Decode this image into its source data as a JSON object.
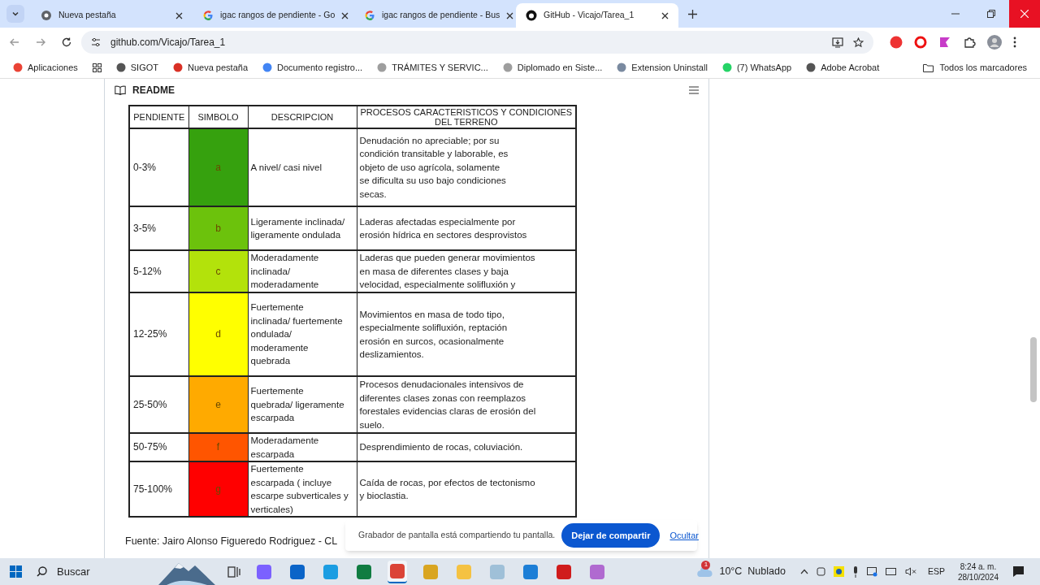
{
  "tabs": [
    {
      "title": "Nueva pestaña",
      "kind": "chrome",
      "selected": false
    },
    {
      "title": "igac rangos de pendiente - Go",
      "kind": "google",
      "selected": false
    },
    {
      "title": "igac rangos de pendiente - Bus",
      "kind": "google",
      "selected": false
    },
    {
      "title": "GitHub - Vicajo/Tarea_1",
      "kind": "github",
      "selected": true
    }
  ],
  "address": "github.com/Vicajo/Tarea_1",
  "bookmarks": [
    {
      "label": "Aplicaciones",
      "color": "#ea4335"
    },
    {
      "label": "SIGOT",
      "color": "#555555"
    },
    {
      "label": "Nueva pestaña",
      "color": "#d93025"
    },
    {
      "label": "Documento registro...",
      "color": "#4285f4"
    },
    {
      "label": "TRÁMITES Y SERVIC...",
      "color": "#9e9e9e"
    },
    {
      "label": "Diplomado en Siste...",
      "color": "#9e9e9e"
    },
    {
      "label": "Extension Uninstall",
      "color": "#7a8aa0"
    },
    {
      "label": "(7) WhatsApp",
      "color": "#25d366"
    },
    {
      "label": "Adobe Acrobat",
      "color": "#555555"
    }
  ],
  "all_bookmarks": "Todos los marcadores",
  "readme_title": "README",
  "table": {
    "columns": [
      "PENDIENTE",
      "SIMBOLO",
      "DESCRIPCION",
      "PROCESOS CARACTERISTICOS Y CONDICIONES\nDEL TERRENO"
    ],
    "rows": [
      {
        "range": "0-3%",
        "symbol": "a",
        "color": "#36a10e",
        "description": "A nivel/ casi nivel",
        "processes": "Denudación no apreciable; por su\ncondición transitable y laborable, es\nobjeto de uso agrícola, solamente\nse dificulta su uso bajo condiciones\nsecas."
      },
      {
        "range": "3-5%",
        "symbol": "b",
        "color": "#6cc20c",
        "description": "Ligeramente inclinada/\nligeramente ondulada",
        "processes": "Laderas afectadas especialmente por\nerosión hídrica en sectores desprovistos"
      },
      {
        "range": "5-12%",
        "symbol": "c",
        "color": "#b3e20b",
        "description": "Moderadamente\ninclinada/\nmoderadamente",
        "processes": "Laderas que pueden generar movimientos\nen masa de diferentes clases y baja\nvelocidad, especialmente solifluxión y"
      },
      {
        "range": "12-25%",
        "symbol": "d",
        "color": "#ffff00",
        "description": "Fuertemente\ninclinada/ fuertemente\nondulada/\nmoderamente\nquebrada",
        "processes": "Movimientos en masa de todo tipo,\nespecialmente solifluxión, reptación\nerosión en surcos, ocasionalmente\ndeslizamientos."
      },
      {
        "range": "25-50%",
        "symbol": "e",
        "color": "#ffaa00",
        "description": "Fuertemente\nquebrada/ ligeramente\nescarpada",
        "processes": "Procesos denudacionales intensivos de\ndiferentes clases zonas con reemplazos\nforestales evidencias claras de erosión del\nsuelo."
      },
      {
        "range": "50-75%",
        "symbol": "f",
        "color": "#ff5500",
        "description": "Moderadamente\nescarpada",
        "processes": "Desprendimiento de rocas, coluviación."
      },
      {
        "range": "75-100%",
        "symbol": "g",
        "color": "#ff0000",
        "description": "Fuertemente\nescarpada ( incluye\nescarpe subverticales y\nverticales)",
        "processes": "Caída de rocas, por efectos de tectonismo\ny bioclastia."
      }
    ]
  },
  "source": "Fuente: Jairo Alonso Figueredo Rodriguez - CL",
  "share_bar": {
    "message": "Grabador de pantalla está compartiendo tu pantalla.",
    "stop": "Dejar de compartir",
    "hide": "Ocultar"
  },
  "taskbar": {
    "search": "Buscar",
    "apps": [
      {
        "selected": false
      },
      {
        "selected": false
      },
      {
        "selected": false
      },
      {
        "selected": false
      },
      {
        "selected": true
      },
      {
        "selected": false
      },
      {
        "selected": false
      },
      {
        "selected": false
      },
      {
        "selected": false
      },
      {
        "selected": false
      },
      {
        "selected": false
      }
    ],
    "weather": "10°C  Nublado",
    "weather_badge": "1",
    "lang": "ESP",
    "time": "8:24 a. m.",
    "date": "28/10/2024"
  }
}
